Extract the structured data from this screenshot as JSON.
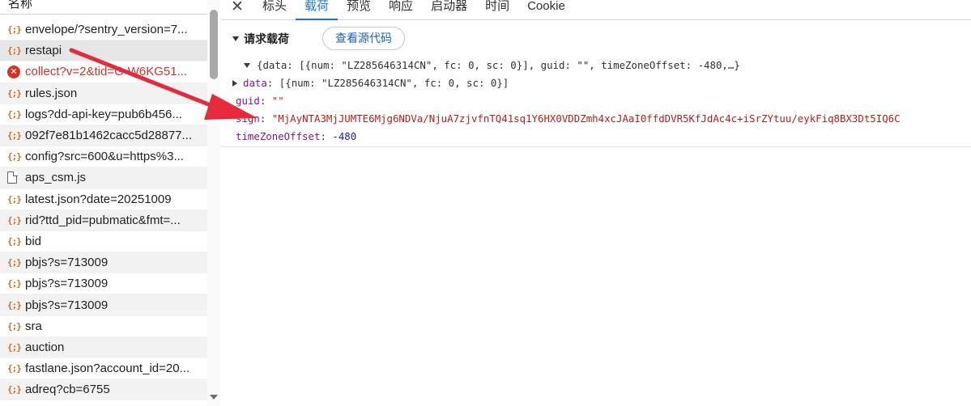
{
  "request_list": {
    "header": "名称",
    "items": [
      {
        "name": "envelope/?sentry_version=7...",
        "icon": "xhr-icon",
        "status": "normal"
      },
      {
        "name": "restapi",
        "icon": "xhr-icon",
        "status": "selected"
      },
      {
        "name": "collect?v=2&tid=G-W6KG51...",
        "icon": "error-icon",
        "status": "error"
      },
      {
        "name": "rules.json",
        "icon": "xhr-icon",
        "status": "normal"
      },
      {
        "name": "logs?dd-api-key=pub6b456...",
        "icon": "xhr-icon",
        "status": "normal"
      },
      {
        "name": "092f7e81b1462cacc5d28877...",
        "icon": "xhr-icon",
        "status": "normal"
      },
      {
        "name": "config?src=600&u=https%3...",
        "icon": "xhr-icon",
        "status": "normal"
      },
      {
        "name": "aps_csm.js",
        "icon": "document-icon",
        "status": "normal"
      },
      {
        "name": "latest.json?date=20251009",
        "icon": "xhr-icon",
        "status": "normal"
      },
      {
        "name": "rid?ttd_pid=pubmatic&fmt=...",
        "icon": "xhr-icon",
        "status": "normal"
      },
      {
        "name": "bid",
        "icon": "xhr-icon",
        "status": "normal"
      },
      {
        "name": "pbjs?s=713009",
        "icon": "xhr-icon",
        "status": "normal"
      },
      {
        "name": "pbjs?s=713009",
        "icon": "xhr-icon",
        "status": "normal"
      },
      {
        "name": "pbjs?s=713009",
        "icon": "xhr-icon",
        "status": "normal"
      },
      {
        "name": "sra",
        "icon": "xhr-icon",
        "status": "normal"
      },
      {
        "name": "auction",
        "icon": "xhr-icon",
        "status": "normal"
      },
      {
        "name": "fastlane.json?account_id=20...",
        "icon": "xhr-icon",
        "status": "normal"
      },
      {
        "name": "adreq?cb=6755",
        "icon": "xhr-icon",
        "status": "normal"
      }
    ]
  },
  "tabs": [
    {
      "label": "标头",
      "active": false
    },
    {
      "label": "载荷",
      "active": true
    },
    {
      "label": "预览",
      "active": false
    },
    {
      "label": "响应",
      "active": false
    },
    {
      "label": "启动器",
      "active": false
    },
    {
      "label": "时间",
      "active": false
    },
    {
      "label": "Cookie",
      "active": false
    }
  ],
  "close_symbol": "✕",
  "xhr_glyph": "{;}",
  "error_glyph": "✕",
  "payload": {
    "section_title": "请求载荷",
    "view_source_label": "查看源代码",
    "summary": "{data: [{num: \"LZ285646314CN\", fc: 0, sc: 0}], guid: \"\", timeZoneOffset: -480,…}",
    "data_key": "data",
    "data_value": "[{num: \"LZ285646314CN\", fc: 0, sc: 0}]",
    "guid_key": "guid",
    "guid_value": "\"\"",
    "sign_key": "sign",
    "sign_value": "\"MjAyNTA3MjJUMTE6Mjg6NDVa/NjuA7zjvfnTQ41sq1Y6HX0VDDZmh4xcJAaI0ffdDVR5KfJdAc4c+iSrZYtuu/eykFiq8BX3Dt5IQ6C",
    "tzo_key": "timeZoneOffset",
    "tzo_value": "-480",
    "colon": ":"
  },
  "colors": {
    "accent": "#1a73e8",
    "annotation_arrow": "#e8293b",
    "string": "#c41a16",
    "key": "#881391",
    "number": "#1a1aa6"
  }
}
